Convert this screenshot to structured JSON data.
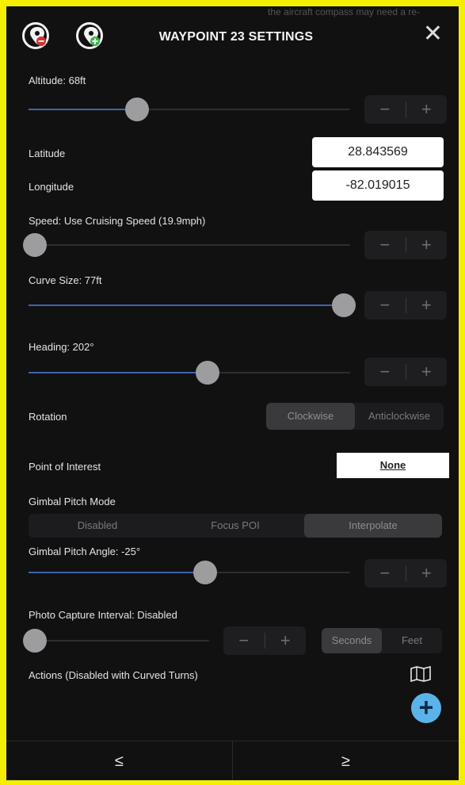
{
  "background_text": "the aircraft compass may need a re-",
  "header": {
    "title": "WAYPOINT 23 SETTINGS",
    "remove_icon": "remove-waypoint-icon",
    "add_icon": "add-waypoint-icon",
    "close_label": "✕"
  },
  "altitude": {
    "label": "Altitude: 68ft",
    "value_fraction": 0.33,
    "minus": "−",
    "plus": "+"
  },
  "latitude": {
    "label": "Latitude",
    "value": "28.843569"
  },
  "longitude": {
    "label": "Longitude",
    "value": "-82.019015"
  },
  "speed": {
    "label": "Speed: Use Cruising Speed (19.9mph)",
    "value_fraction": 0.0,
    "minus": "−",
    "plus": "+"
  },
  "curve_size": {
    "label": "Curve Size: 77ft",
    "value_fraction": 1.0,
    "minus": "−",
    "plus": "+"
  },
  "heading": {
    "label": "Heading: 202°",
    "value_fraction": 0.56,
    "minus": "−",
    "plus": "+"
  },
  "rotation": {
    "label": "Rotation",
    "options": [
      "Clockwise",
      "Anticlockwise"
    ],
    "selected": "Clockwise"
  },
  "poi": {
    "label": "Point of Interest",
    "value": "None"
  },
  "gimbal_mode": {
    "label": "Gimbal Pitch Mode",
    "options": [
      "Disabled",
      "Focus POI",
      "Interpolate"
    ],
    "selected": "Interpolate"
  },
  "gimbal_angle": {
    "label": "Gimbal Pitch Angle: -25°",
    "value_fraction": 0.55,
    "minus": "−",
    "plus": "+"
  },
  "photo_interval": {
    "label": "Photo Capture Interval: Disabled",
    "value_fraction": 0.0,
    "minus": "−",
    "plus": "+",
    "units": [
      "Seconds",
      "Feet"
    ],
    "selected_unit": "Seconds"
  },
  "actions": {
    "label": "Actions (Disabled with Curved Turns)",
    "map_icon": "map-icon",
    "add_icon": "plus-circle-icon",
    "add_label": "+"
  },
  "footer": {
    "prev": "≤",
    "next": "≥"
  },
  "colors": {
    "slider_fill": "#3f63a8",
    "add_button": "#5ab4ea",
    "frame_border": "#f4ee00"
  }
}
